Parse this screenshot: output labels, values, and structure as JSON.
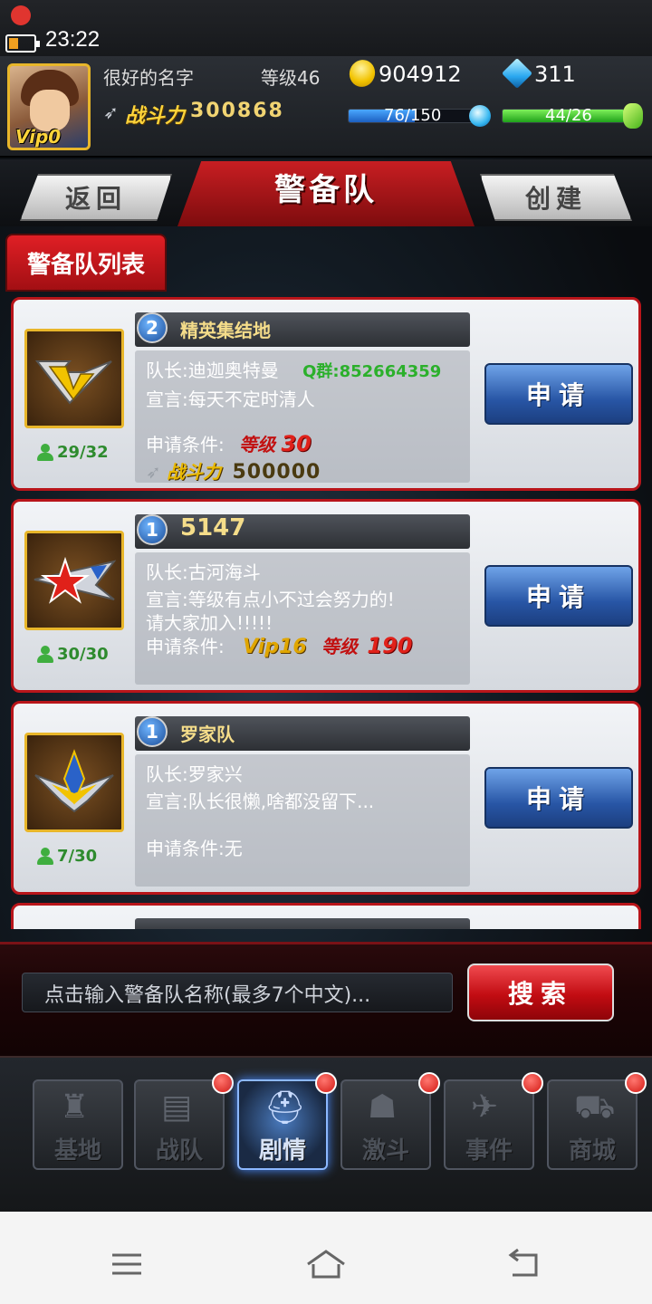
{
  "status_bar": {
    "time": "23:22"
  },
  "player": {
    "vip": "Vip0",
    "name": "很好的名字",
    "level": "等级46",
    "coins": "904912",
    "gems": "311",
    "power_label": "战斗力",
    "power_value": "300868",
    "energy_text": "76/150",
    "energy_fraction": 0.507,
    "stamina_text": "44/26",
    "stamina_fraction": 1.0
  },
  "header": {
    "back_label": "返回",
    "title": "警备队",
    "create_label": "创建"
  },
  "list_tab": "警备队列表",
  "teams": [
    {
      "rank": "2",
      "name": "精英集结地",
      "leader": "队长:迪迦奥特曼",
      "qq": "Q群:852664359",
      "declaration": "宣言:每天不定时清人",
      "declaration2": "",
      "condition_label": "申请条件:",
      "condition_level_tag": "等级",
      "condition_level": "30",
      "condition_power_tag": "战斗力",
      "condition_power": "500000",
      "members": "29/32",
      "apply_label": "申请"
    },
    {
      "rank": "1",
      "name": "5147",
      "leader": "队长:古河海斗",
      "declaration": "宣言:等级有点小不过会努力的!",
      "declaration2": "请大家加入!!!!!",
      "condition_label": "申请条件:",
      "condition_vip": "Vip16",
      "condition_level_tag": "等级",
      "condition_level": "190",
      "members": "30/30",
      "apply_label": "申请"
    },
    {
      "rank": "1",
      "name": "罗家队",
      "leader": "队长:罗家兴",
      "declaration": "宣言:队长很懒,啥都没留下...",
      "condition_label": "申请条件:无",
      "members": "7/30",
      "apply_label": "申请"
    }
  ],
  "search": {
    "placeholder": "点击输入警备队名称(最多7个中文)...",
    "button_label": "搜索"
  },
  "nav": [
    {
      "label": "基地",
      "icon": "castle-icon"
    },
    {
      "label": "战队",
      "icon": "cards-icon"
    },
    {
      "label": "剧情",
      "icon": "hero-helmet-icon"
    },
    {
      "label": "激斗",
      "icon": "monster-icon"
    },
    {
      "label": "事件",
      "icon": "jet-icon"
    },
    {
      "label": "商城",
      "icon": "cart-icon"
    }
  ],
  "colors": {
    "accent_red": "#c81e22",
    "apply_blue": "#2856a6",
    "gold": "#e8b62a"
  }
}
